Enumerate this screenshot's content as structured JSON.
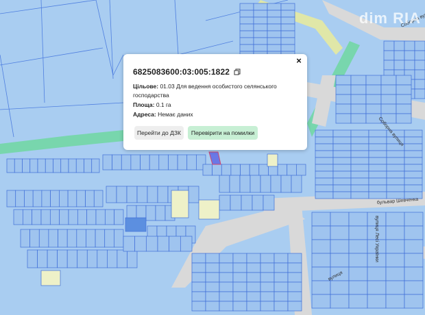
{
  "popup": {
    "cadastral_number": "6825083600:03:005:1822",
    "purpose_label": "Цільове:",
    "purpose_value": "01.03 Для ведення особистого селянського господарства",
    "area_label": "Площа:",
    "area_value": "0.1 га",
    "address_label": "Адреса:",
    "address_value": "Немає даних",
    "btn_dzk": "Перейти до ДЗК",
    "btn_check": "Перевірити на помилки",
    "close_symbol": "×"
  },
  "streets": {
    "s1": "Соборна вулиця",
    "s2": "бульвар Шевченка",
    "s3": "вулиця Лесі Українки",
    "s4": "Соборна вулиця",
    "s5": "вулиця"
  },
  "watermark": "dim RIA",
  "colors": {
    "background": "#a9cdf1",
    "parcel_fill": "#9fc4ef",
    "parcel_stroke": "#3f6ed8",
    "road": "#dcdcdc",
    "green_strip": "#6fd4a6",
    "selected_parcel": "#6a78e6"
  }
}
